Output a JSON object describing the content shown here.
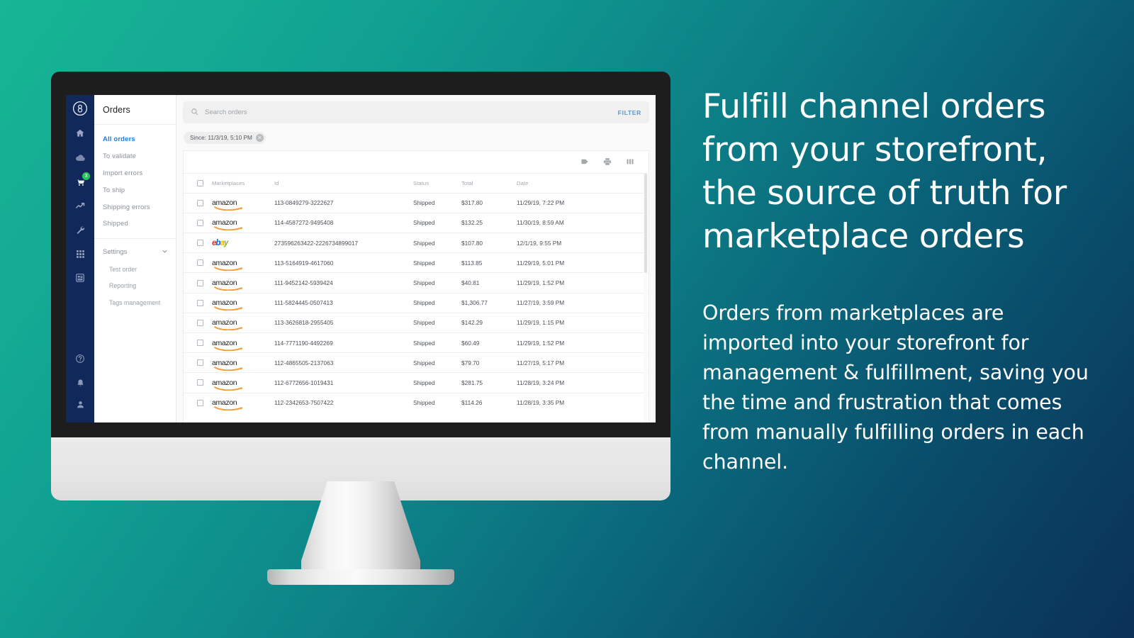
{
  "marketing": {
    "headline": "Fulfill channel orders from your storefront, the source of truth for marketplace orders",
    "body": "Orders from marketplaces are imported into your storefront for management & fulfillment, saving you the time and frustration that comes from manually fulfilling orders in each channel."
  },
  "colors": {
    "background_start": "#17b695",
    "background_end": "#0b3157",
    "sidebar": "#10285a",
    "accent_blue": "#1e7be8",
    "filter_link": "#5b96d8",
    "badge_green": "#22c55e",
    "amazon_orange": "#f79b34",
    "bezel": "#1d1d1d"
  },
  "rail": {
    "logo_name": "app-logo",
    "items": [
      {
        "icon": "home-icon",
        "label": "Home"
      },
      {
        "icon": "cloud-icon",
        "label": "Catalog"
      },
      {
        "icon": "cart-icon",
        "label": "Orders",
        "badge": "3"
      },
      {
        "icon": "trending-up-icon",
        "label": "Analytics"
      },
      {
        "icon": "wrench-icon",
        "label": "Tools"
      },
      {
        "icon": "grid-icon",
        "label": "Apps"
      },
      {
        "icon": "report-icon",
        "label": "Reports"
      }
    ],
    "bottom_items": [
      {
        "icon": "help-icon",
        "label": "Help"
      },
      {
        "icon": "bell-icon",
        "label": "Notifications"
      },
      {
        "icon": "person-icon",
        "label": "Account"
      }
    ]
  },
  "nav": {
    "title": "Orders",
    "items": [
      {
        "label": "All orders",
        "active": true
      },
      {
        "label": "To validate",
        "active": false
      },
      {
        "label": "Import errors",
        "active": false
      },
      {
        "label": "To ship",
        "active": false
      },
      {
        "label": "Shipping errors",
        "active": false
      },
      {
        "label": "Shipped",
        "active": false
      }
    ],
    "settings_label": "Settings",
    "settings_chevron": "chevron-down-icon",
    "sub_items": [
      {
        "label": "Test order"
      },
      {
        "label": "Reporting"
      },
      {
        "label": "Tags management"
      }
    ]
  },
  "search": {
    "placeholder": "Search orders",
    "value": "",
    "icon": "search-icon",
    "filter_label": "FILTER"
  },
  "filter_chip": {
    "label": "Since: 11/3/19, 5:10 PM",
    "remove_icon": "close-icon"
  },
  "toolbar": {
    "icons": [
      {
        "name": "tag-icon",
        "label": "Tags"
      },
      {
        "name": "print-icon",
        "label": "Print"
      },
      {
        "name": "columns-icon",
        "label": "Columns"
      }
    ]
  },
  "table": {
    "columns": [
      "",
      "Marketplaces",
      "Id",
      "Status",
      "Total",
      "Date"
    ],
    "rows": [
      {
        "marketplace": "amazon",
        "id": "113-0849279-3222627",
        "status": "Shipped",
        "total": "$317.80",
        "date": "11/29/19, 7:22 PM"
      },
      {
        "marketplace": "amazon",
        "id": "114-4587272-9495408",
        "status": "Shipped",
        "total": "$132.25",
        "date": "11/30/19, 8:59 AM"
      },
      {
        "marketplace": "ebay",
        "id": "273596263422-2226734899017",
        "status": "Shipped",
        "total": "$107.80",
        "date": "12/1/19, 9:55 PM"
      },
      {
        "marketplace": "amazon",
        "id": "113-5164919-4617060",
        "status": "Shipped",
        "total": "$113.85",
        "date": "11/29/19, 5:01 PM"
      },
      {
        "marketplace": "amazon",
        "id": "111-9452142-5939424",
        "status": "Shipped",
        "total": "$40.81",
        "date": "11/29/19, 1:52 PM"
      },
      {
        "marketplace": "amazon",
        "id": "111-5824445-0507413",
        "status": "Shipped",
        "total": "$1,306.77",
        "date": "11/27/19, 3:59 PM"
      },
      {
        "marketplace": "amazon",
        "id": "113-3626818-2955405",
        "status": "Shipped",
        "total": "$142.29",
        "date": "11/29/19, 1:15 PM"
      },
      {
        "marketplace": "amazon",
        "id": "114-7771190-4492269",
        "status": "Shipped",
        "total": "$60.49",
        "date": "11/29/19, 1:52 PM"
      },
      {
        "marketplace": "amazon",
        "id": "112-4865505-2137063",
        "status": "Shipped",
        "total": "$79.70",
        "date": "11/27/19, 5:17 PM"
      },
      {
        "marketplace": "amazon",
        "id": "112-6772656-1019431",
        "status": "Shipped",
        "total": "$281.75",
        "date": "11/28/19, 3:24 PM"
      },
      {
        "marketplace": "amazon",
        "id": "112-2342653-7507422",
        "status": "Shipped",
        "total": "$114.26",
        "date": "11/28/19, 3:35 PM"
      }
    ]
  }
}
